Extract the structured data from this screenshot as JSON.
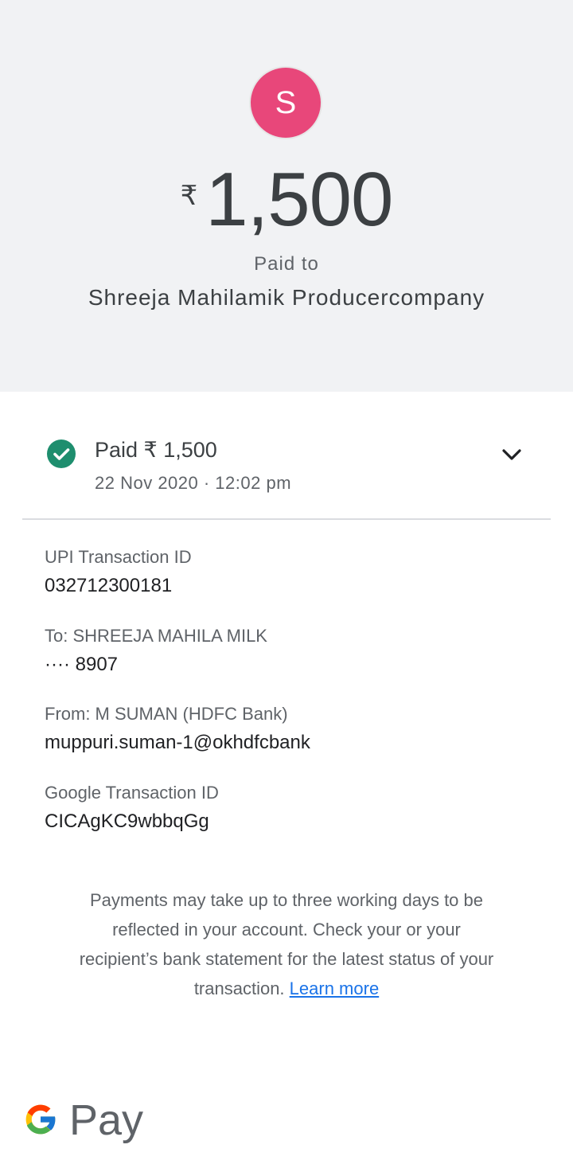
{
  "header": {
    "avatar_letter": "S",
    "currency_symbol": "₹",
    "amount": "1,500",
    "paid_to_label": "Paid to",
    "payee_name": "Shreeja Mahilamik Producercompany"
  },
  "status": {
    "title": "Paid ₹ 1,500",
    "datetime": "22 Nov 2020 · 12:02 pm",
    "icon": "check-circle-icon",
    "expand_icon": "chevron-down-icon"
  },
  "details": [
    {
      "label": "UPI Transaction ID",
      "value": "032712300181"
    },
    {
      "label": "To: SHREEJA MAHILA MILK",
      "value": "···· 8907"
    },
    {
      "label": "From: M SUMAN (HDFC Bank)",
      "value": "muppuri.suman-1@okhdfcbank"
    },
    {
      "label": "Google Transaction ID",
      "value": "CICAgKC9wbbqGg"
    }
  ],
  "note": {
    "text": "Payments may take up to three working days to be reflected in your account. Check your or your recipient’s bank statement for the latest status of your transaction.",
    "link": "Learn more"
  },
  "footer": {
    "brand": "Pay"
  },
  "colors": {
    "header_bg": "#f1f2f4",
    "avatar": "#e8477a",
    "success": "#1e8e6e",
    "link": "#1a73e8"
  }
}
